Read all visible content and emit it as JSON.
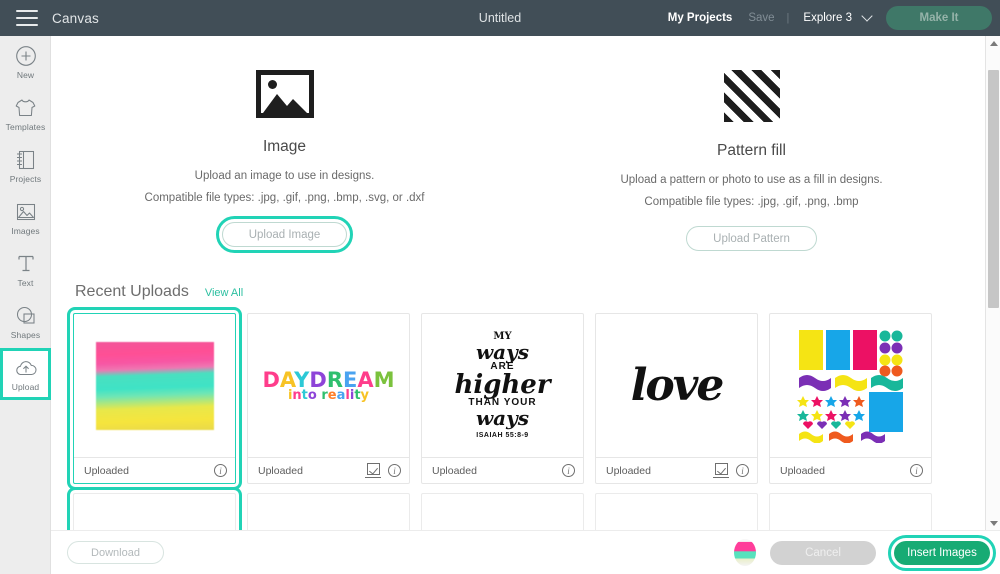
{
  "header": {
    "menu_icon": "hamburger-icon",
    "app_name": "Canvas",
    "document_title": "Untitled",
    "my_projects": "My Projects",
    "save": "Save",
    "divider": "|",
    "explore": "Explore 3",
    "chevron_icon": "chevron-down-icon",
    "make_it": "Make It",
    "bg_color": "#414e57",
    "make_it_color": "#3f7868"
  },
  "sidebar": {
    "items": [
      {
        "label": "New",
        "icon": "plus-circle-icon",
        "selected": false
      },
      {
        "label": "Templates",
        "icon": "shirt-icon",
        "selected": false
      },
      {
        "label": "Projects",
        "icon": "notebook-icon",
        "selected": false
      },
      {
        "label": "Images",
        "icon": "photo-icon",
        "selected": false
      },
      {
        "label": "Text",
        "icon": "text-t-icon",
        "selected": false
      },
      {
        "label": "Shapes",
        "icon": "shapes-icon",
        "selected": false
      },
      {
        "label": "Upload",
        "icon": "upload-cloud-icon",
        "selected": true
      }
    ],
    "bg_color": "#ededed",
    "highlight_color": "#21d3b6"
  },
  "upload_options": [
    {
      "icon": "image-icon",
      "title": "Image",
      "description": "Upload an image to use in designs.",
      "file_types": "Compatible file types: .jpg, .gif, .png, .bmp, .svg, or .dxf",
      "button": "Upload Image",
      "highlighted": true
    },
    {
      "icon": "pattern-stripes-icon",
      "title": "Pattern fill",
      "description": "Upload a pattern or photo to use as a fill in designs.",
      "file_types": "Compatible file types: .jpg, .gif, .png, .bmp",
      "button": "Upload Pattern",
      "highlighted": false
    }
  ],
  "recent_uploads": {
    "title": "Recent Uploads",
    "view_all": "View All",
    "cards": [
      {
        "status": "Uploaded",
        "thumb": "watercolor-gradient",
        "selected": true,
        "has_check_icon": false,
        "info_icon": "info-icon"
      },
      {
        "status": "Uploaded",
        "thumb": "daydream-into-reality",
        "selected": false,
        "has_check_icon": true,
        "info_icon": "info-icon"
      },
      {
        "status": "Uploaded",
        "thumb": "my-ways-are-higher",
        "selected": false,
        "has_check_icon": false,
        "info_icon": "info-icon"
      },
      {
        "status": "Uploaded",
        "thumb": "love-script",
        "selected": false,
        "has_check_icon": true,
        "info_icon": "info-icon"
      },
      {
        "status": "Uploaded",
        "thumb": "sticker-sheet",
        "selected": false,
        "has_check_icon": false,
        "info_icon": "info-icon"
      }
    ],
    "card_art": {
      "daydream": {
        "line1": "DAYDREAM",
        "line2": "into reality"
      },
      "ways": {
        "l1": "MY",
        "l2": "ways",
        "l3": "ARE",
        "l4": "higher",
        "l5": "THAN YOUR",
        "l6": "ways",
        "l7": "ISAIAH 55:8-9"
      },
      "love": {
        "word": "love"
      }
    }
  },
  "footer": {
    "download": "Download",
    "cancel": "Cancel",
    "insert_images": "Insert Images",
    "thumbnail_icon": "selected-image-thumbnail",
    "insert_color": "#17ab74",
    "cancel_color": "#d2d2d2"
  },
  "scrollbar": {
    "up_icon": "scroll-up-arrow-icon",
    "down_icon": "scroll-down-arrow-icon"
  }
}
